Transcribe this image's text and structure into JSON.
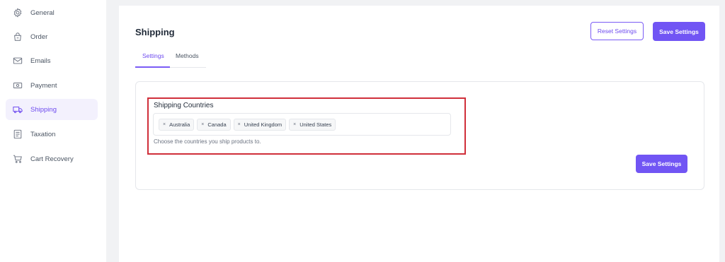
{
  "sidebar": {
    "items": [
      {
        "label": "General",
        "icon": "gear-icon"
      },
      {
        "label": "Order",
        "icon": "bag-icon"
      },
      {
        "label": "Emails",
        "icon": "envelope-icon"
      },
      {
        "label": "Payment",
        "icon": "banknote-icon"
      },
      {
        "label": "Shipping",
        "icon": "truck-icon",
        "active": true
      },
      {
        "label": "Taxation",
        "icon": "receipt-icon"
      },
      {
        "label": "Cart Recovery",
        "icon": "cart-icon"
      }
    ]
  },
  "header": {
    "title": "Shipping",
    "reset_label": "Reset Settings",
    "save_label": "Save Settings"
  },
  "tabs": [
    {
      "label": "Settings",
      "active": true
    },
    {
      "label": "Methods",
      "active": false
    }
  ],
  "shipping_countries": {
    "label": "Shipping Countries",
    "tags": [
      "Australia",
      "Canada",
      "United Kingdom",
      "United States"
    ],
    "tag_remove_glyph": "×",
    "helper": "Choose the countries you ship products to."
  },
  "panel": {
    "save_label": "Save Settings"
  },
  "colors": {
    "accent": "#7155f4",
    "active_bg": "#f3f1fd",
    "highlight": "#d02f3a",
    "gutter": "#f1f2f4"
  }
}
